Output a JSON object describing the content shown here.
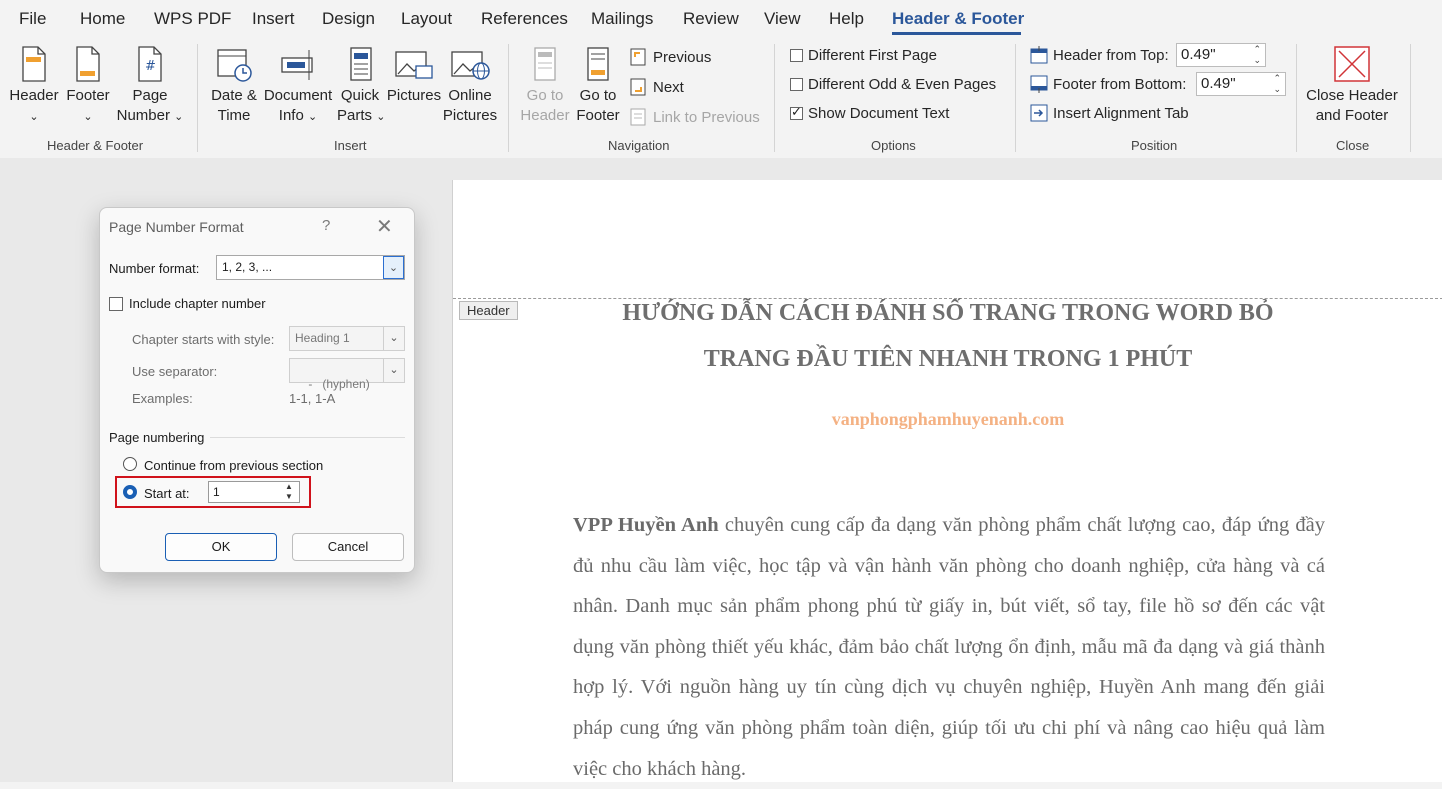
{
  "menu": {
    "items": [
      "File",
      "Home",
      "WPS PDF",
      "Insert",
      "Design",
      "Layout",
      "References",
      "Mailings",
      "Review",
      "View",
      "Help"
    ],
    "active": "Header & Footer"
  },
  "ribbon": {
    "header_footer_group": {
      "label": "Header & Footer",
      "header": "Header",
      "footer": "Footer",
      "page_number_line1": "Page",
      "page_number_line2": "Number"
    },
    "insert_group": {
      "label": "Insert",
      "date_time_line1": "Date &",
      "date_time_line2": "Time",
      "document_info_line1": "Document",
      "document_info_line2": "Info",
      "quick_parts_line1": "Quick",
      "quick_parts_line2": "Parts",
      "pictures": "Pictures",
      "online_pictures_line1": "Online",
      "online_pictures_line2": "Pictures"
    },
    "navigation_group": {
      "label": "Navigation",
      "goto_header_line1": "Go to",
      "goto_header_line2": "Header",
      "goto_footer_line1": "Go to",
      "goto_footer_line2": "Footer",
      "previous": "Previous",
      "next": "Next",
      "link_to_previous": "Link to Previous"
    },
    "options_group": {
      "label": "Options",
      "different_first_page": "Different First Page",
      "different_odd_even": "Different Odd & Even Pages",
      "show_document_text": "Show Document Text"
    },
    "position_group": {
      "label": "Position",
      "header_from_top_label": "Header from Top:",
      "header_from_top_value": "0.49\"",
      "footer_from_bottom_label": "Footer from Bottom:",
      "footer_from_bottom_value": "0.49\"",
      "insert_alignment_tab": "Insert Alignment Tab"
    },
    "close_group": {
      "label": "Close",
      "close_line1": "Close Header",
      "close_line2": "and Footer"
    }
  },
  "document": {
    "header_tag": "Header",
    "title_line1": "HƯỚNG DẪN CÁCH ĐÁNH SỐ TRANG TRONG WORD BỎ",
    "title_line2": "TRANG ĐẦU TIÊN NHANH TRONG 1 PHÚT",
    "site": "vanphongphamhuyenanh.com",
    "body_bold": "VPP Huyền Anh",
    "body_text": " chuyên cung cấp đa dạng văn phòng phẩm chất lượng cao, đáp ứng đầy đủ nhu cầu làm việc, học tập và vận hành văn phòng cho doanh nghiệp, cửa hàng và cá nhân. Danh mục sản phẩm phong phú từ giấy in, bút viết, sổ tay, file hồ sơ đến các vật dụng văn phòng thiết yếu khác, đảm bảo chất lượng ổn định, mẫu mã đa dạng và giá thành hợp lý. Với nguồn hàng uy tín cùng dịch vụ chuyên nghiệp, Huyền Anh mang đến giải pháp cung ứng văn phòng phẩm toàn diện, giúp tối ưu chi phí và nâng cao hiệu quả làm việc cho khách hàng."
  },
  "dialog": {
    "title": "Page Number Format",
    "help": "?",
    "close": "✕",
    "number_format_label": "Number format:",
    "number_format_value": "1, 2, 3, ...",
    "include_chapter": "Include chapter number",
    "chapter_style_label": "Chapter starts with style:",
    "chapter_style_value": "Heading 1",
    "separator_label": "Use separator:",
    "separator_value": "-   (hyphen)",
    "examples_label": "Examples:",
    "examples_value": "1-1, 1-A",
    "page_numbering": "Page numbering",
    "continue_label": "Continue from previous section",
    "start_at_label": "Start at:",
    "start_at_value": "1",
    "ok": "OK",
    "cancel": "Cancel"
  },
  "colors": {
    "accent": "#2b579a",
    "highlight_box": "#d0121b",
    "site_text": "#f4b183"
  }
}
